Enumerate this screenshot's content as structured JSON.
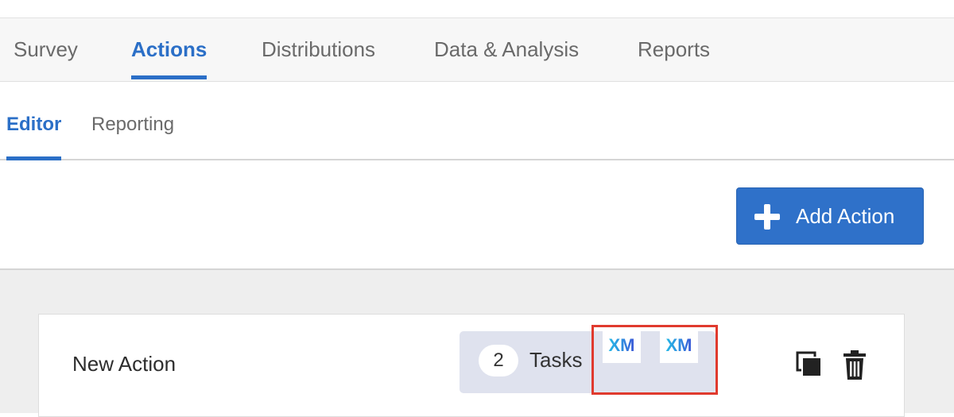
{
  "nav": {
    "tabs": [
      {
        "label": "Survey"
      },
      {
        "label": "Actions"
      },
      {
        "label": "Distributions"
      },
      {
        "label": "Data & Analysis"
      },
      {
        "label": "Reports"
      }
    ],
    "active_tab": "Actions"
  },
  "subnav": {
    "tabs": [
      {
        "label": "Editor"
      },
      {
        "label": "Reporting"
      }
    ],
    "active_tab": "Editor"
  },
  "toolbar": {
    "add_action_label": "Add Action",
    "add_icon": "plus-icon"
  },
  "actions": [
    {
      "name": "New Action",
      "task_count": "2",
      "tasks_label": "Tasks",
      "task_icons": [
        "XM",
        "XM"
      ],
      "icons": [
        "copy-icon",
        "trash-icon"
      ]
    }
  ],
  "colors": {
    "accent": "#2b6fc7",
    "button": "#2f71c9",
    "highlight": "#e03a2e",
    "pill": "#dfe2ee"
  }
}
